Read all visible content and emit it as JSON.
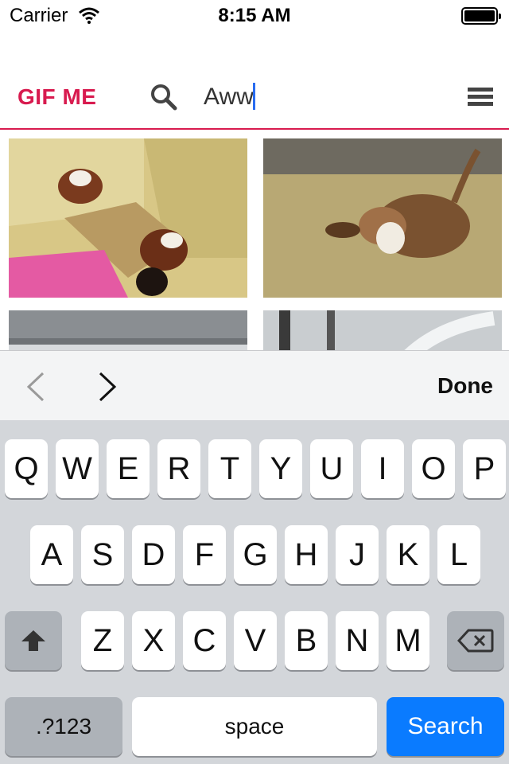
{
  "status_bar": {
    "carrier": "Carrier",
    "time": "8:15 AM"
  },
  "header": {
    "logo": "GIF ME",
    "search_value": "Aww"
  },
  "grid": {
    "items": [
      {
        "alt": "red pandas in a cardboard box"
      },
      {
        "alt": "basset hound running on grass"
      },
      {
        "alt": "snowy landscape"
      },
      {
        "alt": "snowy trees"
      }
    ]
  },
  "keyboard_toolbar": {
    "done_label": "Done"
  },
  "keyboard": {
    "row1": [
      "Q",
      "W",
      "E",
      "R",
      "T",
      "Y",
      "U",
      "I",
      "O",
      "P"
    ],
    "row2": [
      "A",
      "S",
      "D",
      "F",
      "G",
      "H",
      "J",
      "K",
      "L"
    ],
    "row3": [
      "Z",
      "X",
      "C",
      "V",
      "B",
      "N",
      "M"
    ],
    "numbers_label": ".?123",
    "space_label": "space",
    "search_label": "Search"
  },
  "colors": {
    "brand": "#d81b4f",
    "search_key": "#0a7bff",
    "caret": "#2a6cf0"
  },
  "icons": [
    "wifi-icon",
    "battery-icon",
    "search-icon",
    "menu-icon",
    "chevron-left-icon",
    "chevron-right-icon",
    "shift-icon",
    "delete-icon"
  ]
}
